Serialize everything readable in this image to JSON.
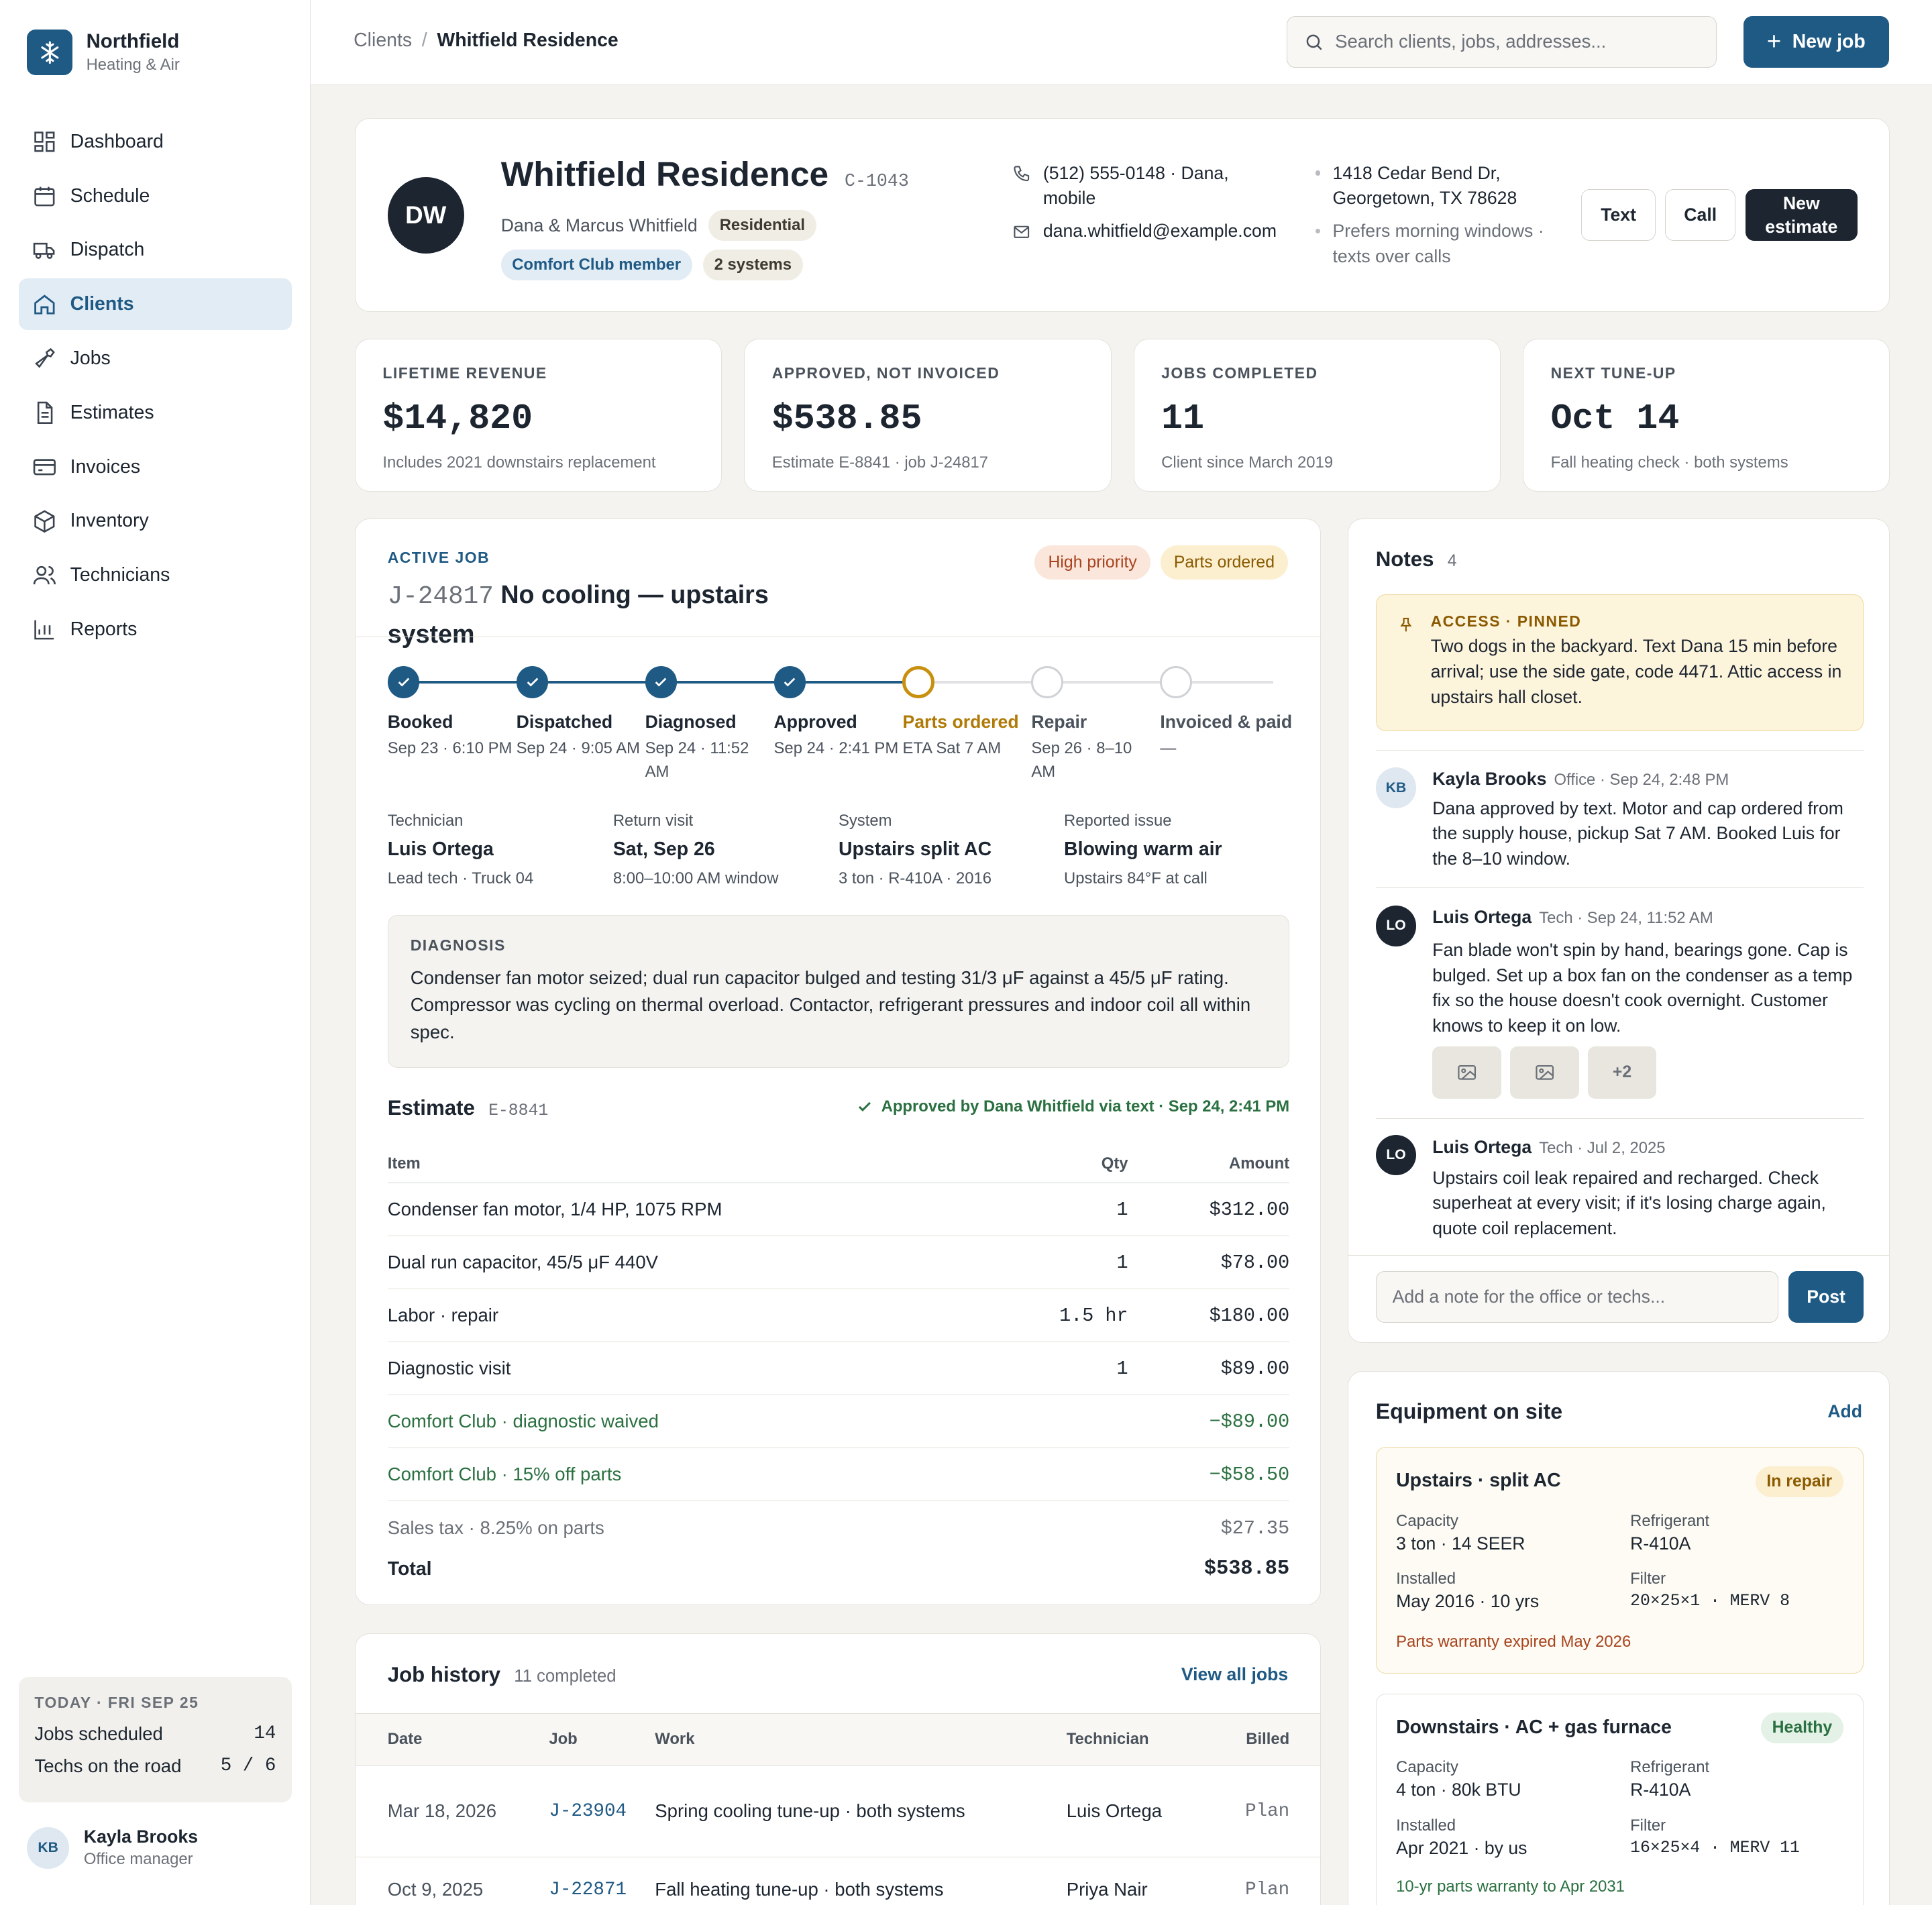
{
  "brand": {
    "name": "Northfield",
    "sub": "Heating & Air"
  },
  "nav": [
    {
      "label": "Dashboard",
      "icon": "dashboard-icon"
    },
    {
      "label": "Schedule",
      "icon": "calendar-icon"
    },
    {
      "label": "Dispatch",
      "icon": "truck-icon"
    },
    {
      "label": "Clients",
      "icon": "home-icon",
      "active": true
    },
    {
      "label": "Jobs",
      "icon": "wrench-icon"
    },
    {
      "label": "Estimates",
      "icon": "document-icon"
    },
    {
      "label": "Invoices",
      "icon": "credit-card-icon"
    },
    {
      "label": "Inventory",
      "icon": "box-icon"
    },
    {
      "label": "Technicians",
      "icon": "users-icon"
    },
    {
      "label": "Reports",
      "icon": "bar-chart-icon"
    }
  ],
  "today": {
    "title": "TODAY · FRI SEP 25",
    "jobs_label": "Jobs scheduled",
    "jobs_value": "14",
    "techs_label": "Techs on the road",
    "techs_value": "5 / 6"
  },
  "user": {
    "initials": "KB",
    "name": "Kayla Brooks",
    "role": "Office manager"
  },
  "breadcrumb": {
    "parent": "Clients",
    "sep": "/",
    "current": "Whitfield Residence"
  },
  "search": {
    "placeholder": "Search clients, jobs, addresses..."
  },
  "new_job": {
    "label": "New job"
  },
  "client": {
    "initials": "DW",
    "name": "Whitfield Residence",
    "id": "C-1043",
    "owners": "Dana & Marcus Whitfield",
    "type": "Residential",
    "membership": "Comfort Club member",
    "systems": "2 systems",
    "phone": "(512) 555-0148 · Dana, mobile",
    "email": "dana.whitfield@example.com",
    "address": "1418 Cedar Bend Dr, Georgetown, TX 78628",
    "preference": "Prefers morning windows · texts over calls",
    "btn_text": "Text",
    "btn_call": "Call",
    "btn_estimate": "New estimate"
  },
  "stats": [
    {
      "label": "LIFETIME REVENUE",
      "value": "$14,820",
      "sub": "Includes 2021 downstairs replacement"
    },
    {
      "label": "APPROVED, NOT INVOICED",
      "value": "$538.85",
      "sub": "Estimate E-8841 · job J-24817"
    },
    {
      "label": "JOBS COMPLETED",
      "value": "11",
      "sub": "Client since March 2019"
    },
    {
      "label": "NEXT TUNE-UP",
      "value": "Oct 14",
      "sub": "Fall heating check · both systems"
    }
  ],
  "job": {
    "section": "ACTIVE JOB",
    "id": "J-24817",
    "title": "No cooling — upstairs system",
    "badges": [
      "High priority",
      "Parts ordered"
    ],
    "steps": [
      {
        "label": "Booked",
        "sub": "Sep 23 · 6:10 PM",
        "state": "done"
      },
      {
        "label": "Dispatched",
        "sub": "Sep 24 · 9:05 AM",
        "state": "done"
      },
      {
        "label": "Diagnosed",
        "sub": "Sep 24 · 11:52 AM",
        "state": "done"
      },
      {
        "label": "Approved",
        "sub": "Sep 24 · 2:41 PM",
        "state": "done"
      },
      {
        "label": "Parts ordered",
        "sub": "ETA Sat 7 AM",
        "state": "current"
      },
      {
        "label": "Repair",
        "sub": "Sep 26 · 8–10 AM",
        "state": "todo"
      },
      {
        "label": "Invoiced & paid",
        "sub": "—",
        "state": "todo"
      }
    ],
    "facts": [
      {
        "k": "Technician",
        "v": "Luis Ortega",
        "s": "Lead tech · Truck 04"
      },
      {
        "k": "Return visit",
        "v": "Sat, Sep 26",
        "s": "8:00–10:00 AM window"
      },
      {
        "k": "System",
        "v": "Upstairs split AC",
        "s": "3 ton · R-410A · 2016"
      },
      {
        "k": "Reported issue",
        "v": "Blowing warm air",
        "s": "Upstairs 84°F at call"
      }
    ],
    "diagnosis_label": "DIAGNOSIS",
    "diagnosis": "Condenser fan motor seized; dual run capacitor bulged and testing 31/3 μF against a 45/5 μF rating. Compressor was cycling on thermal overload. Contactor, refrigerant pressures and indoor coil all within spec."
  },
  "estimate": {
    "title": "Estimate",
    "id": "E-8841",
    "approval": "Approved by Dana Whitfield via text · Sep 24, 2:41 PM",
    "headers": {
      "item": "Item",
      "qty": "Qty",
      "amount": "Amount"
    },
    "lines": [
      {
        "item": "Condenser fan motor, 1/4 HP, 1075 RPM",
        "qty": "1",
        "amount": "$312.00"
      },
      {
        "item": "Dual run capacitor, 45/5 μF 440V",
        "qty": "1",
        "amount": "$78.00"
      },
      {
        "item": "Labor · repair",
        "qty": "1.5 hr",
        "amount": "$180.00"
      },
      {
        "item": "Diagnostic visit",
        "qty": "1",
        "amount": "$89.00"
      }
    ],
    "discounts": [
      {
        "item": "Comfort Club · diagnostic waived",
        "amount": "−$89.00"
      },
      {
        "item": "Comfort Club · 15% off parts",
        "amount": "−$58.50"
      }
    ],
    "tax_label": "Sales tax · 8.25% on parts",
    "tax": "$27.35",
    "total_label": "Total",
    "total": "$538.85"
  },
  "history": {
    "title": "Job history",
    "count": "11 completed",
    "view_all": "View all jobs",
    "headers": {
      "date": "Date",
      "job": "Job",
      "work": "Work",
      "tech": "Technician",
      "billed": "Billed"
    },
    "rows": [
      {
        "date": "Mar 18, 2026",
        "job": "J-23904",
        "work": "Spring cooling tune-up · both systems",
        "tech": "Luis Ortega",
        "billed": "Plan"
      },
      {
        "date": "Oct 9, 2025",
        "job": "J-22871",
        "work": "Fall heating tune-up · both systems",
        "tech": "Priya Nair",
        "billed": "Plan"
      }
    ]
  },
  "notes": {
    "title": "Notes",
    "count": "4",
    "pinned_label": "ACCESS · PINNED",
    "pinned": "Two dogs in the backyard. Text Dana 15 min before arrival; use the side gate, code 4471. Attic access in upstairs hall closet.",
    "items": [
      {
        "initials": "KB",
        "author": "Kayla Brooks",
        "meta": "Office · Sep 24, 2:48 PM",
        "text": "Dana approved by text. Motor and cap ordered from the supply house, pickup Sat 7 AM. Booked Luis for the 8–10 window."
      },
      {
        "initials": "LO",
        "author": "Luis Ortega",
        "meta": "Tech · Sep 24, 11:52 AM",
        "text": "Fan blade won't spin by hand, bearings gone. Cap is bulged. Set up a box fan on the condenser as a temp fix so the house doesn't cook overnight. Customer knows to keep it on low.",
        "more": "+2"
      },
      {
        "initials": "LO",
        "author": "Luis Ortega",
        "meta": "Tech · Jul 2, 2025",
        "text": "Upstairs coil leak repaired and recharged. Check superheat at every visit; if it's losing charge again, quote coil replacement."
      }
    ],
    "input_placeholder": "Add a note for the office or techs...",
    "post": "Post"
  },
  "equipment": {
    "title": "Equipment on site",
    "add": "Add",
    "units": [
      {
        "name": "Upstairs · split AC",
        "status": "In repair",
        "capacity_k": "Capacity",
        "capacity": "3 ton · 14 SEER",
        "refrigerant_k": "Refrigerant",
        "refrigerant": "R-410A",
        "installed_k": "Installed",
        "installed": "May 2016 · 10 yrs",
        "filter_k": "Filter",
        "filter": "20×25×1 · MERV 8",
        "note": "Parts warranty expired May 2026"
      },
      {
        "name": "Downstairs · AC + gas furnace",
        "status": "Healthy",
        "capacity_k": "Capacity",
        "capacity": "4 ton · 80k BTU",
        "refrigerant_k": "Refrigerant",
        "refrigerant": "R-410A",
        "installed_k": "Installed",
        "installed": "Apr 2021 · by us",
        "filter_k": "Filter",
        "filter": "16×25×4 · MERV 11",
        "note": "10-yr parts warranty to Apr 2031"
      }
    ]
  },
  "colors": {
    "accent": "#1f5a85",
    "dark": "#1c2530",
    "warn": "#c8900e",
    "success": "#2a7040",
    "danger": "#a8431d"
  }
}
